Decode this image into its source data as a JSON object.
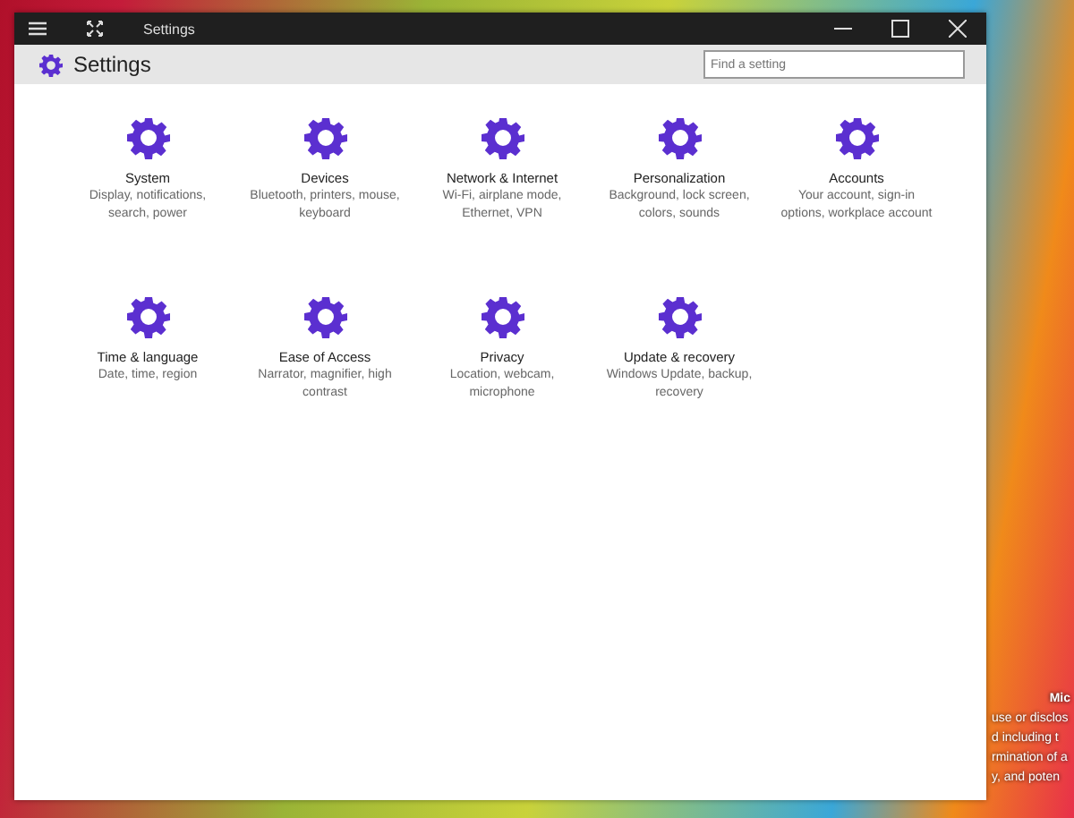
{
  "window": {
    "title": "Settings"
  },
  "header": {
    "title": "Settings",
    "search": {
      "placeholder": "Find a setting"
    }
  },
  "categories": [
    {
      "title": "System",
      "description": "Display, notifications, search, power"
    },
    {
      "title": "Devices",
      "description": "Bluetooth, printers, mouse, keyboard"
    },
    {
      "title": "Network & Internet",
      "description": "Wi-Fi, airplane mode, Ethernet, VPN"
    },
    {
      "title": "Personalization",
      "description": "Background, lock screen, colors, sounds"
    },
    {
      "title": "Accounts",
      "description": "Your account, sign-in options, workplace account"
    },
    {
      "title": "Time & language",
      "description": "Date, time, region"
    },
    {
      "title": "Ease of Access",
      "description": "Narrator, magnifier, high contrast"
    },
    {
      "title": "Privacy",
      "description": "Location, webcam, microphone"
    },
    {
      "title": "Update & recovery",
      "description": "Windows Update, backup, recovery"
    }
  ],
  "desktop_text": [
    "Mic",
    "use or disclos",
    "d including t",
    "rmination of a",
    "y, and poten"
  ]
}
